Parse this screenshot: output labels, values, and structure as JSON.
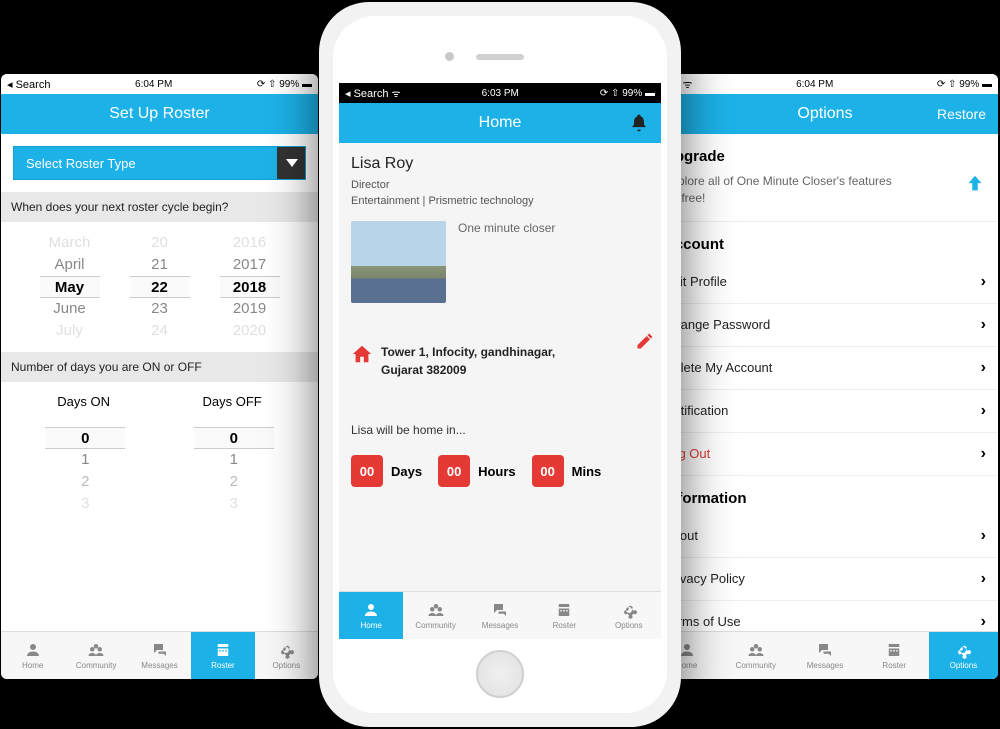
{
  "statusBar": {
    "back": "◂ Search",
    "wifi": "📶",
    "timeLeft": "6:04 PM",
    "timeCenter": "6:03 PM",
    "timeRight": "6:04 PM",
    "right": "⟳ ⇧ 99% ▬"
  },
  "left": {
    "headerTitle": "Set Up Roster",
    "selectLabel": "Select Roster Type",
    "questionCycle": "When does your next roster cycle begin?",
    "datePicker": {
      "months": [
        "March",
        "April",
        "May",
        "June",
        "July"
      ],
      "days": [
        "20",
        "21",
        "22",
        "23",
        "24"
      ],
      "years": [
        "2016",
        "2017",
        "2018",
        "2019",
        "2020"
      ]
    },
    "questionDays": "Number of days you are ON or OFF",
    "daysOnLabel": "Days ON",
    "daysOffLabel": "Days OFF",
    "daysPicker": {
      "on": [
        "0",
        "1",
        "2",
        "3"
      ],
      "off": [
        "0",
        "1",
        "2",
        "3"
      ]
    }
  },
  "center": {
    "headerTitle": "Home",
    "name": "Lisa Roy",
    "role": "Director",
    "company": "Entertainment | Prismetric technology",
    "thumbLabel": "One minute closer",
    "address1": "Tower 1, Infocity, gandhinagar,",
    "address2": "Gujarat  382009",
    "countdownLabel": "Lisa will be home in...",
    "countdown": {
      "daysVal": "00",
      "daysLbl": "Days",
      "hoursVal": "00",
      "hoursLbl": "Hours",
      "minsVal": "00",
      "minsLbl": "Mins"
    }
  },
  "right": {
    "headerTitle": "Options",
    "headerAction": "Restore",
    "upgradeTitle": "Upgrade",
    "upgradeText": "Explore all of One Minute Closer's features ad-free!",
    "accountTitle": "Account",
    "accountItems": [
      "Edit Profile",
      "Change Password",
      "Delete My Account",
      "Notification",
      "Log Out"
    ],
    "infoTitle": "Information",
    "infoItems": [
      "About",
      "Privacy Policy",
      "Terms of Use"
    ]
  },
  "tabs": [
    "Home",
    "Community",
    "Messages",
    "Roster",
    "Options"
  ]
}
